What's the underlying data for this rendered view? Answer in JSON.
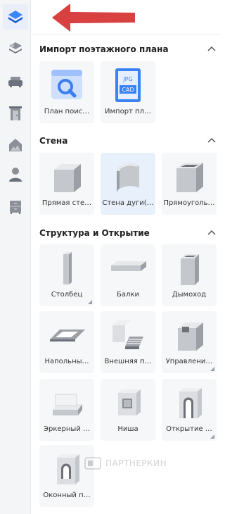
{
  "rail": {
    "items": [
      {
        "name": "rail-item-floorplan",
        "icon": "blue-layers-icon",
        "active": true
      },
      {
        "name": "rail-item-layers",
        "icon": "stacked-layers-icon",
        "active": false
      },
      {
        "name": "rail-item-furniture",
        "icon": "sofa-icon",
        "active": false
      },
      {
        "name": "rail-item-doors",
        "icon": "door-icon",
        "active": false
      },
      {
        "name": "rail-item-exterior",
        "icon": "house-icon",
        "active": false
      },
      {
        "name": "rail-item-people",
        "icon": "person-icon",
        "active": false
      },
      {
        "name": "rail-item-cabinets",
        "icon": "cabinet-icon",
        "active": false
      }
    ]
  },
  "sections": [
    {
      "title": "Импорт поэтажного плана",
      "items": [
        {
          "label": "План поис…",
          "icon": "search-plan-icon"
        },
        {
          "label": "Импорт пл…",
          "icon": "cad-import-icon"
        }
      ]
    },
    {
      "title": "Стена",
      "items": [
        {
          "label": "Прямая сте…",
          "icon": "straight-wall-icon"
        },
        {
          "label": "Стена дуги(…",
          "icon": "arc-wall-icon",
          "selected": true
        },
        {
          "label": "Прямоуголь…",
          "icon": "rectangular-wall-icon"
        }
      ]
    },
    {
      "title": "Структура и Открытие",
      "items": [
        {
          "label": "Столбец",
          "icon": "column-icon",
          "more": true
        },
        {
          "label": "Балки",
          "icon": "beam-icon"
        },
        {
          "label": "Дымоход",
          "icon": "chimney-icon"
        },
        {
          "label": "Напольны…",
          "icon": "floor-opening-icon"
        },
        {
          "label": "Внешняя п…",
          "icon": "exterior-stairs-icon"
        },
        {
          "label": "Управлени…",
          "icon": "control-box-icon",
          "more": true
        },
        {
          "label": "Эркерный …",
          "icon": "bay-window-icon"
        },
        {
          "label": "Ниша",
          "icon": "niche-icon"
        },
        {
          "label": "Открытие …",
          "icon": "arch-opening-icon",
          "more": true
        },
        {
          "label": "Оконный п…",
          "icon": "window-opening-icon"
        }
      ]
    }
  ],
  "watermark": {
    "text": "ПАРТНЕРКИН"
  },
  "colors": {
    "accent": "#2f7cf6",
    "arrow": "#d94040"
  }
}
